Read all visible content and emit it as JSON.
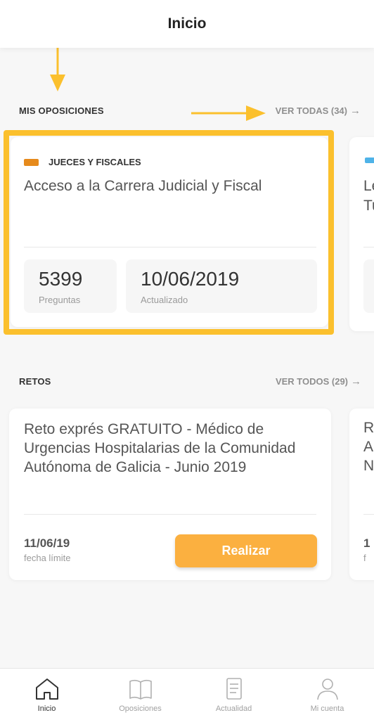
{
  "header": {
    "title": "Inicio"
  },
  "oposiciones": {
    "section_label": "MIS OPOSICIONES",
    "see_all": "VER TODAS (34)",
    "card": {
      "category": "JUECES Y FISCALES",
      "category_color": "#e68a1c",
      "title": "Acceso a la Carrera Judicial y Fiscal",
      "questions_value": "5399",
      "questions_label": "Preguntas",
      "updated_value": "10/06/2019",
      "updated_label": "Actualizado"
    },
    "peek_card": {
      "category_color": "#4fb3e8",
      "line1": "Le",
      "line2": "Tu"
    }
  },
  "retos": {
    "section_label": "RETOS",
    "see_all": "VER TODOS (29)",
    "card": {
      "title": "Reto exprés GRATUITO - Médico de Urgencias Hospitalarias de la Comunidad Autónoma de Galicia - Junio 2019",
      "date": "11/06/19",
      "date_label": "fecha límite",
      "button_label": "Realizar"
    },
    "peek_card": {
      "line1": "R",
      "line2": "A",
      "line3": "N",
      "date_partial": "1",
      "sub_partial": "f"
    }
  },
  "annotations": {
    "color": "#fbc02d"
  },
  "bottom_nav": [
    {
      "label": "Inicio",
      "icon": "home-icon",
      "active": true
    },
    {
      "label": "Oposiciones",
      "icon": "book-icon",
      "active": false
    },
    {
      "label": "Actualidad",
      "icon": "document-icon",
      "active": false
    },
    {
      "label": "Mi cuenta",
      "icon": "user-icon",
      "active": false
    }
  ]
}
